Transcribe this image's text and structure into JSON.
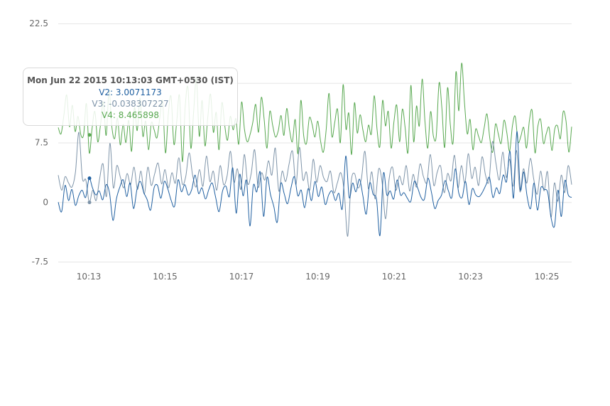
{
  "chart_data": {
    "type": "line",
    "title": "",
    "xlabel": "",
    "ylabel": "",
    "ylim": [
      -7.5,
      22.5
    ],
    "xlim_minutes": [
      12.2,
      25.65
    ],
    "grid": "horizontal",
    "y_ticks": [
      -7.5,
      0,
      7.5,
      22.5
    ],
    "y_tick_labels": [
      "-7.5",
      "0",
      "7.5",
      "22.5"
    ],
    "x_ticks": [
      "10:13",
      "10:15",
      "10:17",
      "10:19",
      "10:21",
      "10:23",
      "10:25"
    ],
    "series": [
      {
        "name": "V2",
        "color": "#1f5fa0",
        "values": [
          0.0,
          -1.2,
          2.1,
          0.2,
          1.6,
          -0.4,
          0.8,
          1.5,
          0.6,
          3.0,
          1.8,
          0.9,
          1.4,
          0.3,
          2.2,
          1.1,
          -2.3,
          0.4,
          1.9,
          2.8,
          0.7,
          2.4,
          -0.8,
          1.6,
          2.6,
          1.2,
          0.3,
          -1.0,
          1.8,
          2.1,
          0.5,
          2.6,
          1.7,
          0.2,
          -0.5,
          2.8,
          1.3,
          2.2,
          0.9,
          1.6,
          3.4,
          1.1,
          1.8,
          0.4,
          1.6,
          2.4,
          0.6,
          -1.2,
          1.4,
          2.0,
          0.7,
          4.3,
          -1.4,
          3.5,
          0.8,
          2.7,
          -3.0,
          2.1,
          1.3,
          3.8,
          -1.8,
          3.1,
          1.0,
          -0.6,
          -2.5,
          2.3,
          1.1,
          -0.2,
          1.8,
          3.2,
          0.8,
          1.5,
          -0.7,
          1.7,
          0.2,
          2.6,
          0.7,
          1.9,
          -0.3,
          0.9,
          1.4,
          0.2,
          1.1,
          -0.8,
          5.8,
          0.6,
          2.4,
          1.3,
          2.9,
          0.8,
          -1.5,
          2.4,
          1.0,
          0.3,
          -4.2,
          3.6,
          0.9,
          1.4,
          0.4,
          2.8,
          0.9,
          1.2,
          0.5,
          0.1,
          2.6,
          1.8,
          0.6,
          0.4,
          3.0,
          1.3,
          -0.8,
          0.2,
          0.9,
          2.7,
          1.4,
          0.6,
          4.2,
          1.2,
          0.6,
          2.6,
          -0.3,
          1.7,
          0.9,
          0.7,
          1.3,
          2.2,
          3.1,
          0.6,
          1.8,
          1.1,
          3.4,
          2.6,
          6.4,
          0.5,
          8.9,
          1.6,
          3.8,
          0.7,
          -0.8,
          2.4,
          -1.0,
          1.8,
          1.6,
          1.2,
          -2.0,
          -3.0,
          1.5,
          -1.8,
          2.7,
          0.9,
          0.6
        ]
      },
      {
        "name": "V3",
        "color": "#7d93a8",
        "values": [
          3.4,
          1.5,
          3.2,
          2.4,
          1.9,
          3.8,
          8.8,
          3.0,
          2.8,
          -0.03,
          1.5,
          0.2,
          2.9,
          4.8,
          0.7,
          7.4,
          1.8,
          4.6,
          3.2,
          1.8,
          3.6,
          2.2,
          4.4,
          1.6,
          3.9,
          1.0,
          4.4,
          2.1,
          3.6,
          4.9,
          2.3,
          4.1,
          1.8,
          3.7,
          2.4,
          5.6,
          2.3,
          3.2,
          6.2,
          3.4,
          1.9,
          4.1,
          2.0,
          5.8,
          2.6,
          3.9,
          1.5,
          4.6,
          2.2,
          3.3,
          6.4,
          2.5,
          4.2,
          1.6,
          6.0,
          2.3,
          3.6,
          6.6,
          1.9,
          3.7,
          2.8,
          5.2,
          3.4,
          6.8,
          1.4,
          3.9,
          2.6,
          4.8,
          6.4,
          2.2,
          6.9,
          2.8,
          3.8,
          1.5,
          5.4,
          2.5,
          4.6,
          3.1,
          2.6,
          3.9,
          1.2,
          2.4,
          3.7,
          1.3,
          -4.3,
          2.5,
          3.6,
          1.8,
          3.0,
          6.4,
          1.7,
          3.8,
          0.4,
          4.2,
          2.5,
          -2.1,
          2.8,
          4.4,
          1.5,
          3.3,
          2.2,
          4.6,
          1.4,
          3.5,
          1.9,
          4.8,
          3.2,
          2.5,
          6.0,
          2.1,
          3.8,
          4.5,
          1.2,
          3.6,
          2.7,
          5.9,
          1.8,
          4.6,
          2.4,
          6.1,
          3.0,
          4.4,
          2.1,
          5.7,
          3.4,
          2.6,
          7.6,
          5.0,
          2.8,
          6.3,
          3.1,
          5.4,
          2.0,
          6.5,
          1.3,
          4.2,
          2.4,
          5.5,
          2.9,
          1.0,
          3.9,
          1.4,
          3.8,
          -1.9,
          2.4,
          0.1,
          3.4,
          1.2,
          4.6,
          2.2
        ]
      },
      {
        "name": "V4",
        "color": "#58a850",
        "values": [
          9.4,
          8.6,
          10.9,
          13.5,
          9.5,
          12.2,
          8.9,
          10.8,
          8.5,
          8.5,
          12.4,
          6.2,
          9.3,
          11.4,
          7.6,
          9.8,
          12.6,
          8.4,
          14.1,
          9.5,
          8.0,
          10.6,
          7.2,
          9.8,
          7.5,
          10.3,
          6.4,
          11.9,
          9.0,
          13.1,
          8.3,
          10.2,
          6.6,
          10.0,
          9.1,
          8.1,
          10.6,
          12.7,
          6.2,
          11.0,
          13.3,
          7.3,
          10.1,
          13.4,
          5.1,
          12.0,
          14.4,
          6.8,
          11.4,
          15.5,
          8.3,
          12.8,
          7.1,
          10.6,
          13.6,
          8.8,
          11.3,
          6.6,
          12.5,
          9.7,
          7.8,
          10.8,
          9.1,
          10.5,
          7.3,
          12.6,
          9.2,
          7.6,
          8.5,
          10.1,
          12.3,
          8.8,
          13.2,
          10.4,
          6.8,
          11.4,
          9.7,
          8.2,
          9.0,
          10.9,
          8.4,
          11.8,
          9.1,
          7.6,
          10.4,
          6.1,
          12.8,
          8.4,
          7.4,
          10.6,
          9.8,
          8.2,
          10.2,
          7.7,
          6.3,
          9.2,
          13.7,
          8.3,
          10.0,
          11.7,
          7.5,
          14.8,
          9.2,
          11.2,
          6.0,
          12.5,
          8.7,
          11.0,
          9.1,
          7.6,
          9.7,
          8.6,
          13.4,
          9.2,
          7.0,
          12.8,
          9.6,
          11.4,
          6.8,
          10.1,
          12.2,
          7.6,
          11.7,
          9.3,
          6.3,
          14.7,
          7.6,
          12.1,
          9.6,
          15.5,
          10.2,
          6.8,
          11.4,
          8.3,
          8.3,
          15.0,
          11.8,
          6.9,
          14.4,
          9.7,
          7.6,
          16.4,
          11.5,
          17.5,
          12.6,
          8.6,
          10.4,
          6.6,
          9.2,
          8.3,
          7.5,
          9.4,
          11.1,
          8.0,
          6.3,
          9.8,
          8.6,
          7.4,
          10.3,
          8.8,
          6.4,
          9.6,
          10.8,
          7.6,
          8.3,
          9.4,
          6.8,
          10.2,
          11.5,
          6.2,
          9.5,
          10.4,
          7.4,
          8.6,
          9.4,
          6.5,
          9.2,
          9.6,
          8.0,
          11.4,
          10.2,
          6.3,
          9.5
        ]
      }
    ]
  },
  "tooltip": {
    "title": "Mon Jun 22 2015 10:13:03 GMT+0530 (IST)",
    "rows": [
      {
        "label": "V2: 3.0071173",
        "color": "#1f5fa0"
      },
      {
        "label": "V3: -0.038307227",
        "color": "#7d93a8"
      },
      {
        "label": "V4: 8.465898",
        "color": "#58a850"
      }
    ]
  }
}
